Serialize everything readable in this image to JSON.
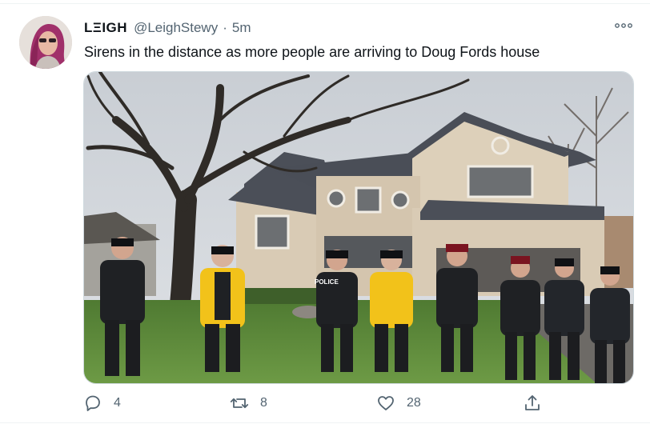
{
  "tweet": {
    "author": {
      "display_name": "LΞIGH",
      "handle": "@LeighStewy",
      "separator": "·",
      "timestamp": "5m"
    },
    "text": "Sirens in the distance as more people are arriving to Doug Fords house",
    "media": {
      "police_vest_text": "POLICE"
    },
    "actions": {
      "reply_count": "4",
      "retweet_count": "8",
      "like_count": "28"
    }
  },
  "icons": {
    "more": "more-horizontal-icon",
    "reply": "reply-icon",
    "retweet": "retweet-icon",
    "like": "heart-icon",
    "share": "share-icon"
  },
  "colors": {
    "text_primary": "#0f1419",
    "text_secondary": "#536471",
    "border": "#cfd9de"
  }
}
